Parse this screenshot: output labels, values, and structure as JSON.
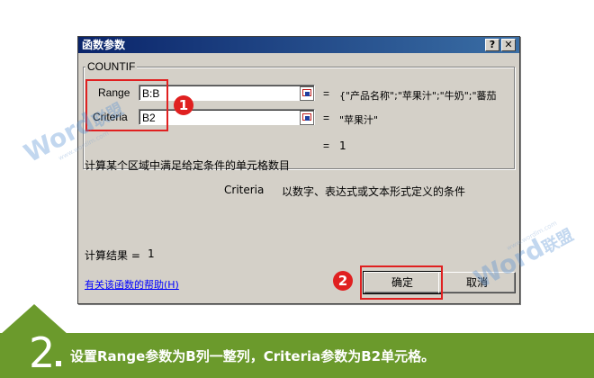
{
  "dialog": {
    "title": "函数参数",
    "help_button": "?",
    "close_button": "✕",
    "function_name": "COUNTIF",
    "args": [
      {
        "label": "Range",
        "value": "B:B",
        "result": "{\"产品名称\";\"苹果汁\";\"牛奶\";\"蕃茄"
      },
      {
        "label": "Criteria",
        "value": "B2",
        "result": "\"苹果汁\""
      }
    ],
    "equals": "=",
    "function_result": "1",
    "description": "计算某个区域中满足给定条件的单元格数目",
    "arg_description_name": "Criteria",
    "arg_description_text": "以数字、表达式或文本形式定义的条件",
    "calc_result_label": "计算结果 =",
    "calc_result_value": "1",
    "help_link": "有关该函数的帮助(H)",
    "ok_button": "确定",
    "cancel_button": "取消"
  },
  "annotations": {
    "badge_1": "1",
    "badge_2": "2",
    "highlight_color": "#e02020"
  },
  "watermark": {
    "brand_en": "Word",
    "brand_cn": "联盟",
    "url": "www.wordlm.com"
  },
  "step": {
    "number": "2",
    "text": "设置Range参数为B列一整列，Criteria参数为B2单元格。",
    "color": "#6b9a2c"
  }
}
